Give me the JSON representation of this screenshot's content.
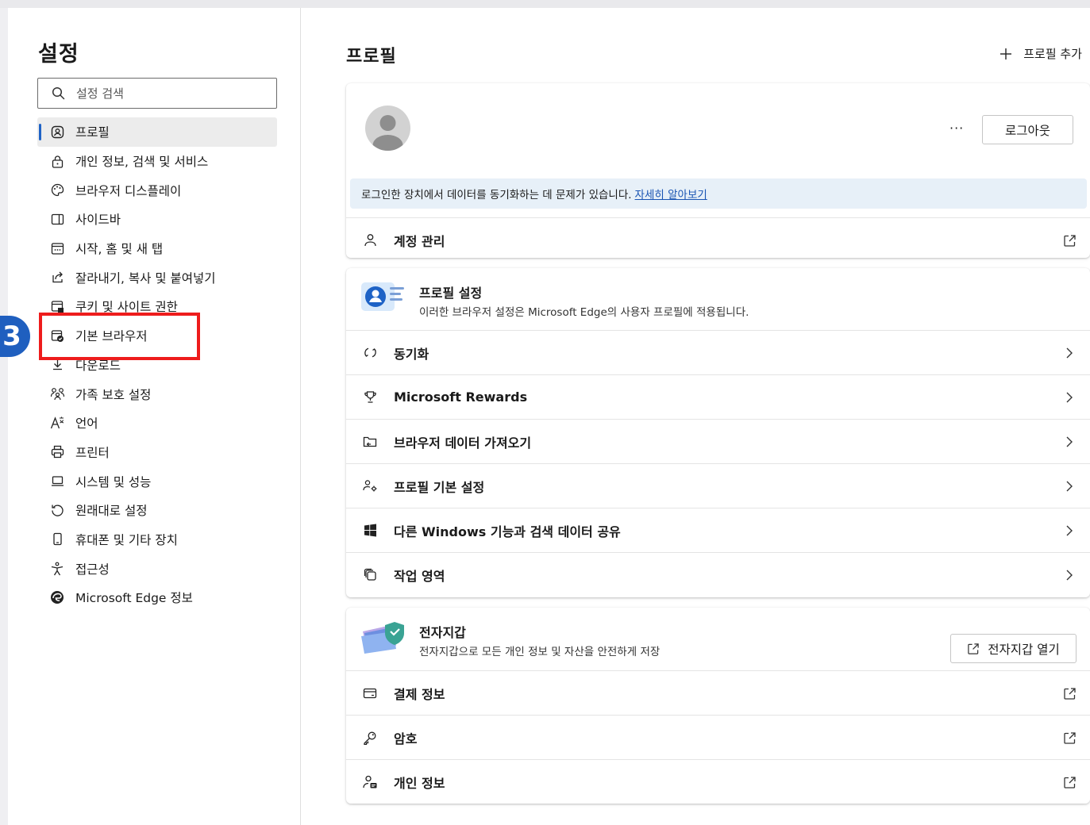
{
  "sidebar": {
    "title": "설정",
    "search_placeholder": "설정 검색",
    "items": [
      {
        "label": "프로필",
        "icon": "profile-icon"
      },
      {
        "label": "개인 정보, 검색 및 서비스",
        "icon": "lock-icon"
      },
      {
        "label": "브라우저 디스플레이",
        "icon": "palette-icon"
      },
      {
        "label": "사이드바",
        "icon": "sidebar-icon"
      },
      {
        "label": "시작, 홈 및 새 탭",
        "icon": "home-tab-icon"
      },
      {
        "label": "잘라내기, 복사 및 붙여넣기",
        "icon": "share-icon"
      },
      {
        "label": "쿠키 및 사이트 권한",
        "icon": "cookie-permission-icon"
      },
      {
        "label": "기본 브라우저",
        "icon": "default-browser-icon"
      },
      {
        "label": "다운로드",
        "icon": "download-icon"
      },
      {
        "label": "가족 보호 설정",
        "icon": "family-icon"
      },
      {
        "label": "언어",
        "icon": "language-icon"
      },
      {
        "label": "프린터",
        "icon": "printer-icon"
      },
      {
        "label": "시스템 및 성능",
        "icon": "laptop-icon"
      },
      {
        "label": "원래대로 설정",
        "icon": "reset-icon"
      },
      {
        "label": "휴대폰 및 기타 장치",
        "icon": "phone-icon"
      },
      {
        "label": "접근성",
        "icon": "accessibility-icon"
      },
      {
        "label": "Microsoft Edge 정보",
        "icon": "edge-logo-icon"
      }
    ],
    "step_badge": "3"
  },
  "main": {
    "title": "프로필",
    "add_profile": "프로필 추가",
    "profile_card": {
      "more": "···",
      "logout": "로그아웃",
      "notice": "로그인한 장치에서 데이터를 동기화하는 데 문제가 있습니다.",
      "notice_link": "자세히 알아보기",
      "account_manage": "계정 관리"
    },
    "profile_settings": {
      "title": "프로필 설정",
      "description": "이러한 브라우저 설정은 Microsoft Edge의 사용자 프로필에 적용됩니다.",
      "rows": [
        {
          "label": "동기화",
          "icon": "sync-icon"
        },
        {
          "label": "Microsoft Rewards",
          "icon": "trophy-icon"
        },
        {
          "label": "브라우저 데이터 가져오기",
          "icon": "import-icon"
        },
        {
          "label": "프로필 기본 설정",
          "icon": "profile-preferences-icon"
        },
        {
          "label": "다른 Windows 기능과 검색 데이터 공유",
          "icon": "windows-icon"
        },
        {
          "label": "작업 영역",
          "icon": "workspaces-icon"
        }
      ]
    },
    "wallet": {
      "title": "전자지갑",
      "description": "전자지갑으로 모든 개인 정보 및 자산을 안전하게 저장",
      "open_button": "전자지갑 열기",
      "rows": [
        {
          "label": "결제 정보",
          "icon": "card-icon"
        },
        {
          "label": "암호",
          "icon": "key-icon"
        },
        {
          "label": "개인 정보",
          "icon": "personal-info-icon"
        }
      ]
    }
  },
  "colors": {
    "accent": "#1f63c6",
    "highlight_box": "#ee1c1c",
    "step_badge": "#1f5fbf",
    "notice_bg": "#e7f0f8",
    "link": "#1a55b3"
  }
}
